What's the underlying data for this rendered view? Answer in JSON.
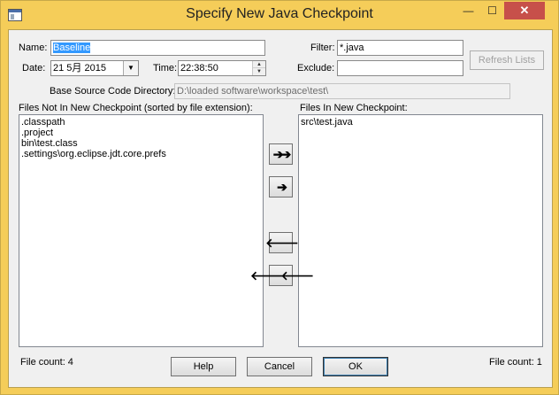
{
  "window": {
    "title": "Specify New Java Checkpoint",
    "minimize_glyph": "—",
    "maximize_glyph": "☐",
    "close_glyph": "✕"
  },
  "form": {
    "name_label": "Name:",
    "name_value": "Baseline",
    "date_label": "Date:",
    "date_value": "21  5月  2015",
    "time_label": "Time:",
    "time_value": "22:38:50",
    "filter_label": "Filter:",
    "filter_value": "*.java",
    "exclude_label": "Exclude:",
    "exclude_value": "",
    "refresh_label": "Refresh Lists",
    "base_dir_label": "Base Source Code Directory:",
    "base_dir_value": "D:\\loaded software\\workspace\\test\\"
  },
  "left_list": {
    "header": "Files Not In New Checkpoint (sorted by file extension):",
    "items": [
      ".classpath",
      ".project",
      "bin\\test.class",
      ".settings\\org.eclipse.jdt.core.prefs"
    ],
    "count_text": "File count: 4"
  },
  "right_list": {
    "header": "Files In New Checkpoint:",
    "items": [
      "src\\test.java"
    ],
    "count_text": "File count: 1"
  },
  "move_buttons": {
    "add_all": "➔➔",
    "add_one": "➔",
    "remove_one": "🡐",
    "remove_all": "🡐🡐"
  },
  "actions": {
    "help": "Help",
    "cancel": "Cancel",
    "ok": "OK"
  },
  "colors": {
    "titlebar": "#f5cd59",
    "close_button": "#c7504a",
    "selection": "#3399ff",
    "dialog_bg": "#f0f0f0"
  },
  "icons": {
    "window": "app-window-icon",
    "date_dropdown": "chevron-down-icon",
    "time_spinner": "spin-updown-icon"
  }
}
